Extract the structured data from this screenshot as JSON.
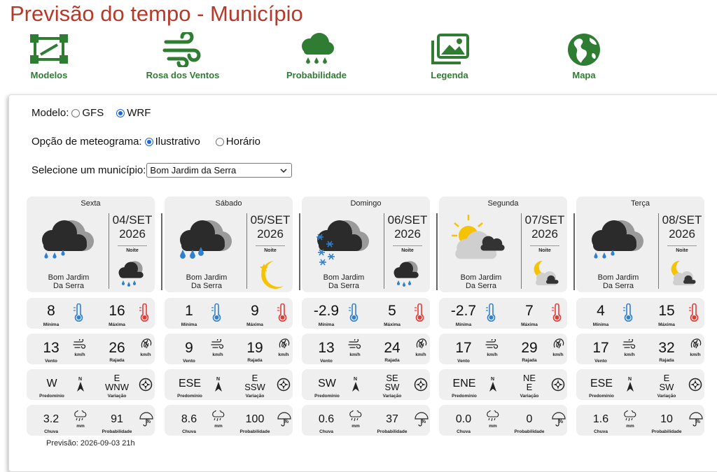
{
  "page_title": "Previsão do tempo - Município",
  "toolbar": [
    {
      "label": "Modelos",
      "icon": "models-icon"
    },
    {
      "label": "Rosa dos Ventos",
      "icon": "wind-rose-icon"
    },
    {
      "label": "Probabilidade",
      "icon": "rain-cloud-icon"
    },
    {
      "label": "Legenda",
      "icon": "gallery-icon"
    },
    {
      "label": "Mapa",
      "icon": "globe-icon"
    }
  ],
  "form": {
    "model_label": "Modelo:",
    "model_options": [
      "GFS",
      "WRF"
    ],
    "model_selected": "WRF",
    "meteogram_label": "Opção de meteograma:",
    "meteogram_options": [
      "Ilustrativo",
      "Horário"
    ],
    "meteogram_selected": "Ilustrativo",
    "city_label": "Selecione um município:",
    "city_value": "Bom Jardim da Serra"
  },
  "labels": {
    "noite": "Noite",
    "minima": "Mínima",
    "maxima": "Máxima",
    "vento": "Vento",
    "rajada": "Rajada",
    "kmh": "km/h",
    "predominio": "Predomínio",
    "variacao": "Variação",
    "chuva": "Chuva",
    "mm": "mm",
    "probabilidade": "Probabilidade"
  },
  "days": [
    {
      "name": "Sexta",
      "date": "04/SET",
      "year": "2026",
      "city_line1": "Bom Jardim",
      "city_line2": "Da Serra",
      "day_icon": "rain-cloud-icon",
      "night_icon": "night-rain-cloud-icon",
      "min": "8",
      "max": "16",
      "wind": "13",
      "gust": "26",
      "dir": "W",
      "var1": "E",
      "var2": "WNW",
      "rain": "3.2",
      "prob": "91"
    },
    {
      "name": "Sábado",
      "date": "05/SET",
      "year": "2026",
      "city_line1": "Bom Jardim",
      "city_line2": "Da Serra",
      "day_icon": "heavy-rain-cloud-icon",
      "night_icon": "moon-star-icon",
      "min": "1",
      "max": "9",
      "wind": "9",
      "gust": "19",
      "dir": "ESE",
      "var1": "E",
      "var2": "SSW",
      "rain": "8.6",
      "prob": "100"
    },
    {
      "name": "Domingo",
      "date": "06/SET",
      "year": "2026",
      "city_line1": "Bom Jardim",
      "city_line2": "Da Serra",
      "day_icon": "snow-cloud-icon",
      "night_icon": "night-rain-cloud-icon",
      "min": "-2.9",
      "max": "5",
      "wind": "13",
      "gust": "24",
      "dir": "SW",
      "var1": "SE",
      "var2": "SW",
      "rain": "0.6",
      "prob": "37"
    },
    {
      "name": "Segunda",
      "date": "07/SET",
      "year": "2026",
      "city_line1": "Bom Jardim",
      "city_line2": "Da Serra",
      "day_icon": "sun-cloud-icon",
      "night_icon": "moon-cloud-icon",
      "min": "-2.7",
      "max": "7",
      "wind": "17",
      "gust": "29",
      "dir": "ENE",
      "var1": "NE",
      "var2": "E",
      "rain": "0.0",
      "prob": "0"
    },
    {
      "name": "Terça",
      "date": "08/SET",
      "year": "2026",
      "city_line1": "Bom Jardim",
      "city_line2": "Da Serra",
      "day_icon": "rain-cloud-icon",
      "night_icon": "moon-cloud-icon",
      "min": "4",
      "max": "15",
      "wind": "17",
      "gust": "32",
      "dir": "ESE",
      "var1": "E",
      "var2": "SW",
      "rain": "1.6",
      "prob": "10"
    }
  ],
  "forecast_text": "Previsão: 2026-09-03 21h",
  "colors": {
    "title": "#b53a2a",
    "toolbar": "#2e7d32",
    "cold": "#2f80d0",
    "hot": "#e53935",
    "cloud": "#333333",
    "sun": "#f7c300"
  }
}
